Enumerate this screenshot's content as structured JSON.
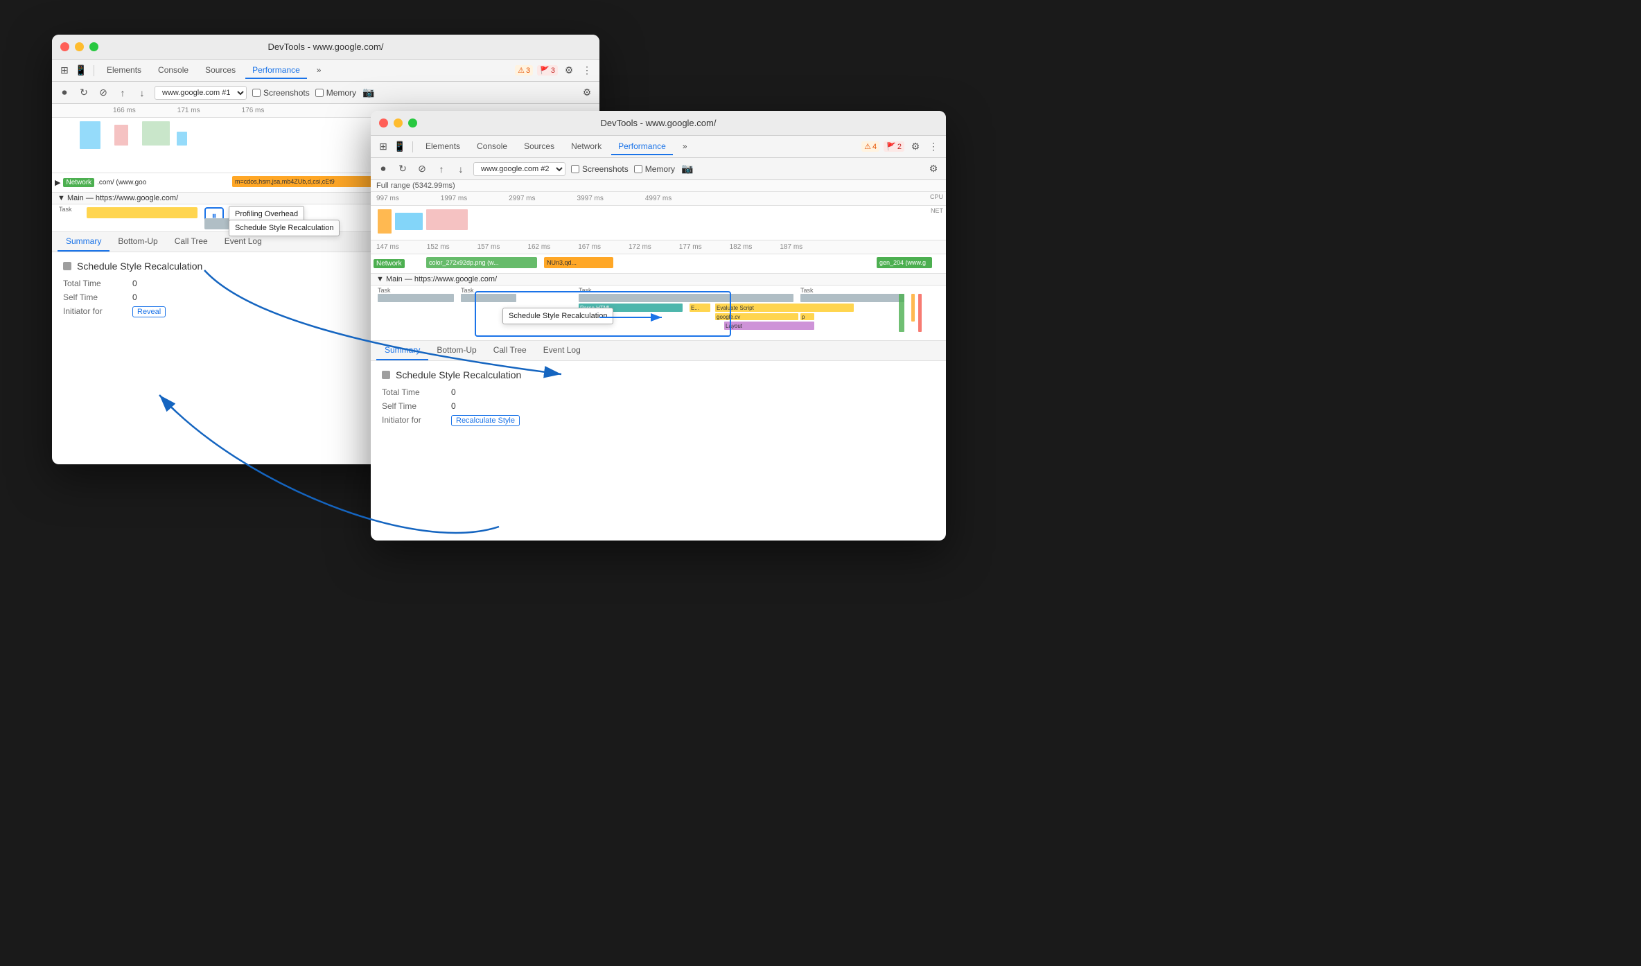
{
  "background": "#1a1a1a",
  "window_back": {
    "title": "DevTools - www.google.com/",
    "tabs": [
      "Elements",
      "Console",
      "Sources",
      "Performance"
    ],
    "active_tab": "Performance",
    "target": "www.google.com #1",
    "checkboxes": [
      "Screenshots",
      "Memory"
    ],
    "badges": [
      {
        "type": "warn",
        "count": "3"
      },
      {
        "type": "err",
        "count": "3"
      }
    ],
    "ruler_marks": [
      "166 ms",
      "171 ms",
      "176 ms"
    ],
    "network_label": "Network",
    "network_url": ".com/ (www.goo",
    "network_bar2": "m=cdos,hsm,jsa,mb4ZUb,d,csi,cEt9",
    "main_label": "Main — https://www.google.com/",
    "task_label": "Task",
    "profiling_overhead": "Profiling Overhead",
    "schedule_style": "Schedule Style Recalculation",
    "bottom_tabs": [
      "Summary",
      "Bottom-Up",
      "Call Tree",
      "Event Log"
    ],
    "active_bottom_tab": "Summary",
    "summary_title": "Schedule Style Recalculation",
    "total_time_label": "Total Time",
    "total_time_value": "0",
    "self_time_label": "Self Time",
    "self_time_value": "0",
    "initiator_label": "Initiator for",
    "reveal_label": "Reveal"
  },
  "window_front": {
    "title": "DevTools - www.google.com/",
    "tabs": [
      "Elements",
      "Console",
      "Sources",
      "Network",
      "Performance"
    ],
    "active_tab": "Performance",
    "target": "www.google.com #2",
    "checkboxes": [
      "Screenshots",
      "Memory"
    ],
    "badges": [
      {
        "type": "warn",
        "count": "4"
      },
      {
        "type": "err",
        "count": "2"
      }
    ],
    "full_range": "Full range (5342.99ms)",
    "ruler_marks": [
      "997 ms",
      "1997 ms",
      "2997 ms",
      "3997 ms",
      "4997 ms"
    ],
    "ruler2_marks": [
      "147 ms",
      "152 ms",
      "157 ms",
      "162 ms",
      "167 ms",
      "172 ms",
      "177 ms",
      "182 ms",
      "187 ms"
    ],
    "cpu_label": "CPU",
    "net_label": "NET",
    "network_label": "Network",
    "network_bar1": "color_272x92dp.png (w...",
    "network_bar2": "NUn3,qd...",
    "network_bar3": "gen_204 (www.g",
    "main_label": "Main — https://www.google.com/",
    "task_labels": [
      "Task",
      "Task",
      "Task",
      "Task"
    ],
    "flame_labels": [
      "Parse HTML",
      "E...",
      "Evaluate Script",
      "google.cv",
      "p",
      "Layout"
    ],
    "schedule_style_callout": "Schedule Style Recalculation",
    "bottom_tabs": [
      "Summary",
      "Bottom-Up",
      "Call Tree",
      "Event Log"
    ],
    "active_bottom_tab": "Summary",
    "summary_title": "Schedule Style Recalculation",
    "total_time_label": "Total Time",
    "total_time_value": "0",
    "self_time_label": "Self Time",
    "self_time_value": "0",
    "initiator_label": "Initiator for",
    "recalculate_label": "Recalculate Style"
  }
}
